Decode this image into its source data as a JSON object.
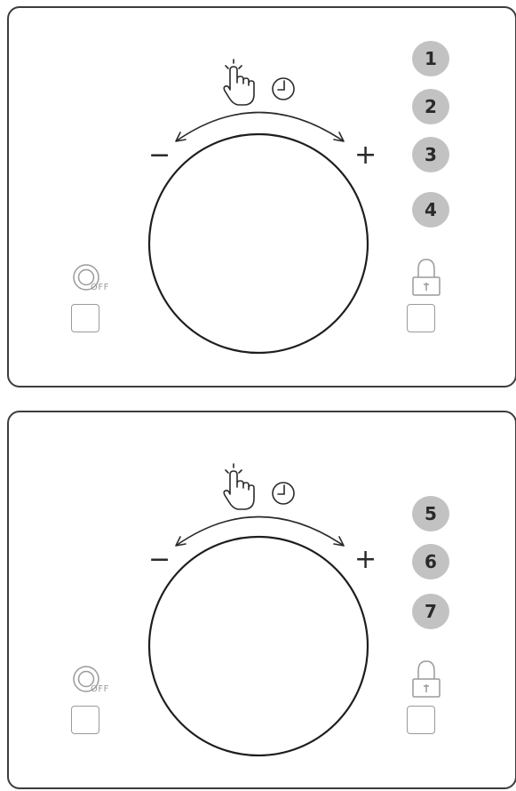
{
  "panels": [
    {
      "minus_label": "−",
      "plus_label": "+",
      "off_label": "OFF",
      "badges": [
        "1",
        "2",
        "3",
        "4"
      ]
    },
    {
      "minus_label": "−",
      "plus_label": "+",
      "off_label": "OFF",
      "badges": [
        "5",
        "6",
        "7"
      ]
    }
  ],
  "colors": {
    "badge_fill": "#c2c2c2",
    "outline": "#3d3d3d",
    "muted_icon": "#9a9a9a"
  },
  "icons": [
    "touch-hand-icon",
    "clock-icon",
    "power-off-icon",
    "lock-icon"
  ]
}
